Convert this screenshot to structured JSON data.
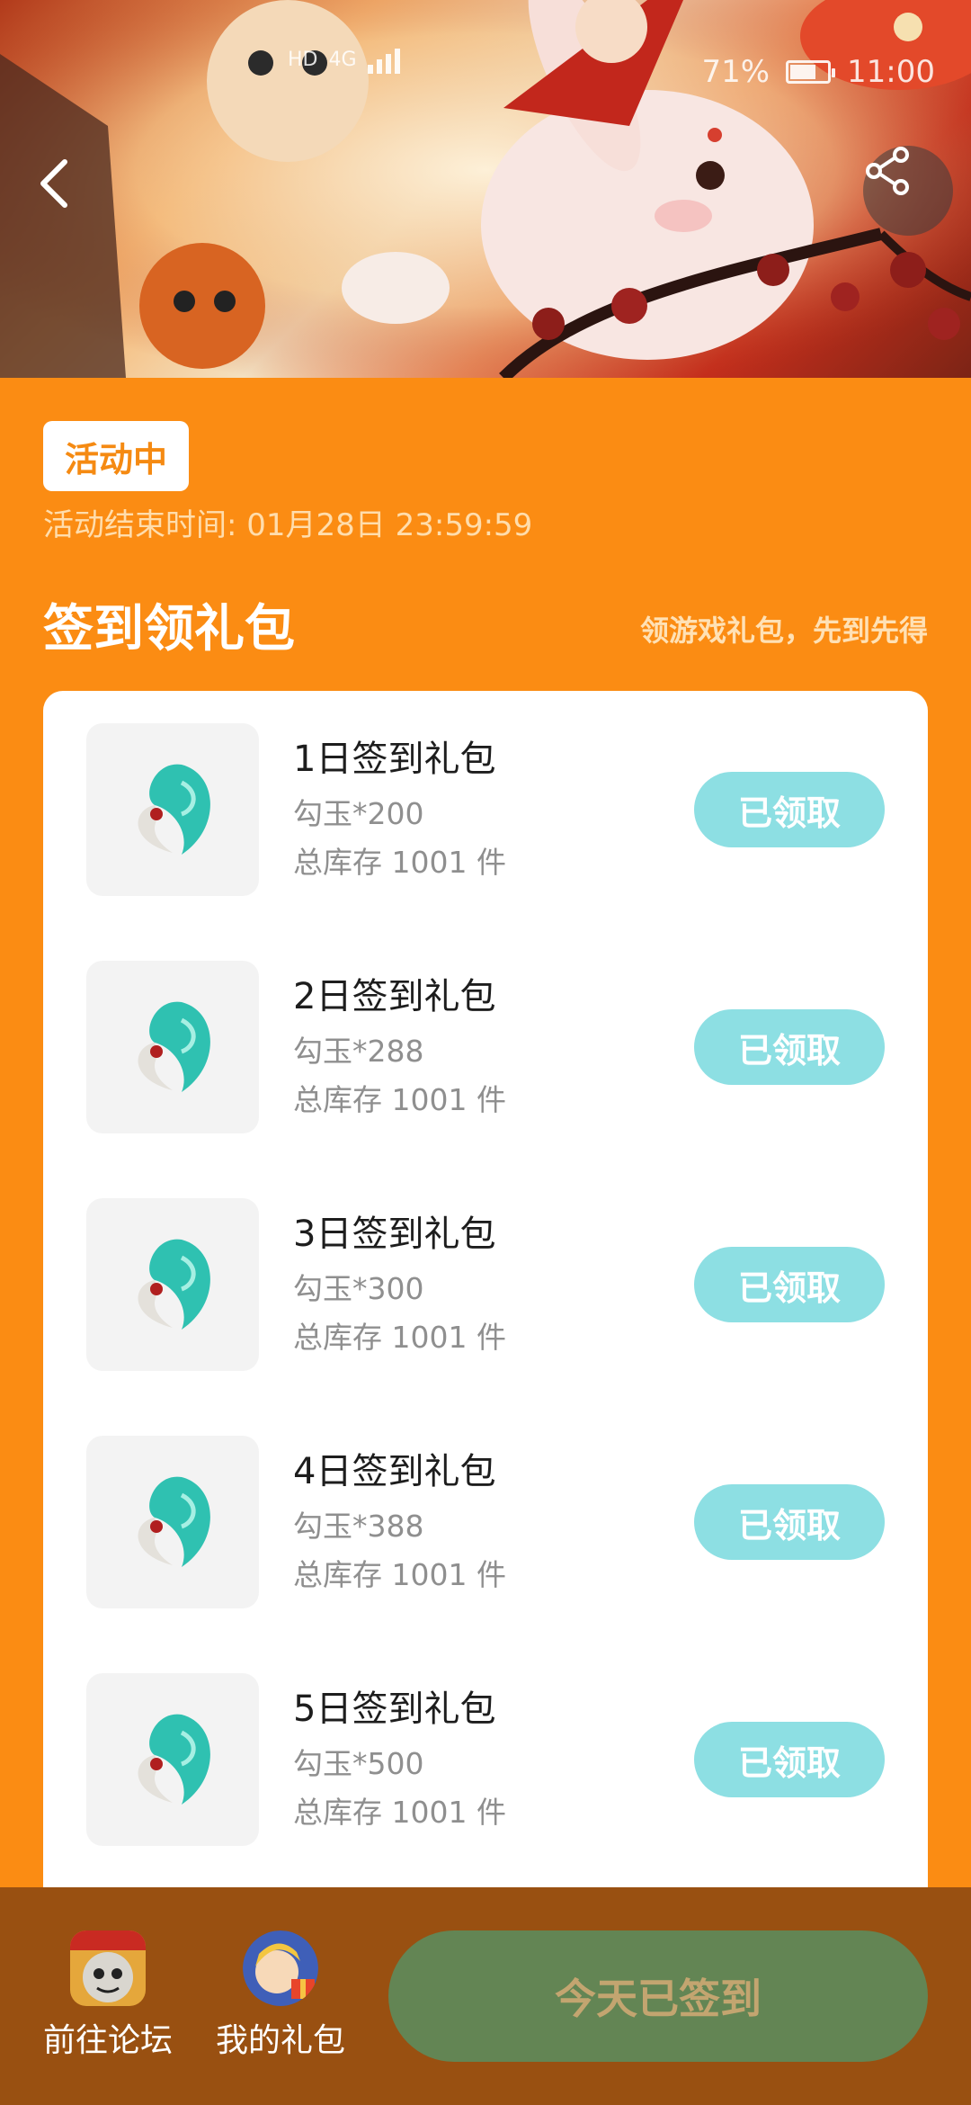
{
  "status_bar": {
    "network_label": "HD",
    "signal_label": "4G",
    "battery_percent": "71%",
    "battery_level": 0.71,
    "time": "11:00"
  },
  "nav": {
    "back_icon": "chevron-left-icon",
    "share_icon": "share-icon"
  },
  "activity": {
    "status": "活动中",
    "end_time": "活动结束时间: 01月28日 23:59:59"
  },
  "section": {
    "title": "签到领礼包",
    "subtitle": "领游戏礼包，先到先得"
  },
  "gifts": [
    {
      "title": "1日签到礼包",
      "reward": "勾玉*200",
      "stock": "总库存 1001 件",
      "button": "已领取"
    },
    {
      "title": "2日签到礼包",
      "reward": "勾玉*288",
      "stock": "总库存 1001 件",
      "button": "已领取"
    },
    {
      "title": "3日签到礼包",
      "reward": "勾玉*300",
      "stock": "总库存 1001 件",
      "button": "已领取"
    },
    {
      "title": "4日签到礼包",
      "reward": "勾玉*388",
      "stock": "总库存 1001 件",
      "button": "已领取"
    },
    {
      "title": "5日签到礼包",
      "reward": "勾玉*500",
      "stock": "总库存 1001 件",
      "button": "已领取"
    }
  ],
  "bottom": {
    "forum_label": "前往论坛",
    "gifts_label": "我的礼包",
    "checkin_label": "今天已签到"
  },
  "colors": {
    "background": "#fb8c13",
    "claim_button": "#8ddfe3",
    "bottom_bar": "#995011",
    "checkin_button": "#638554",
    "checkin_text": "#c3a570"
  }
}
